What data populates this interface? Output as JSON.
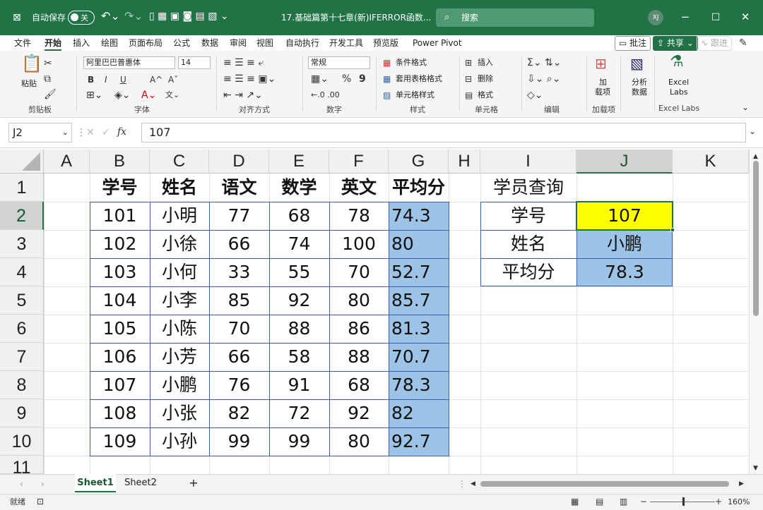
{
  "titlebar": {
    "autosave_label": "自动保存",
    "autosave_state": "关",
    "filename": "17.基础篇第十七章(新)IFERROR函数... ⌄",
    "search_placeholder": "搜索",
    "user_initials": "XJ",
    "accent": "#217346"
  },
  "menu": {
    "items": [
      "文件",
      "开始",
      "插入",
      "绘图",
      "页面布局",
      "公式",
      "数据",
      "审阅",
      "视图",
      "自动执行",
      "开发工具",
      "预览版",
      "Power Pivot"
    ],
    "active": "开始",
    "comments": "批注",
    "share": "共享",
    "follow": "跟进"
  },
  "ribbon": {
    "clipboard": {
      "paste": "粘贴",
      "group": "剪贴板"
    },
    "font": {
      "name": "阿里巴巴普惠体",
      "size": "14",
      "bold": "B",
      "italic": "I",
      "underline": "U",
      "grow": "A^",
      "shrink": "Aˇ",
      "group": "字体"
    },
    "alignment": {
      "group": "对齐方式"
    },
    "number": {
      "format": "常规",
      "percent": "%",
      "comma": "9",
      "group": "数字"
    },
    "styles": {
      "cond": "条件格式",
      "table": "套用表格格式",
      "cell": "单元格样式",
      "group": "样式"
    },
    "cells": {
      "insert": "插入",
      "delete": "删除",
      "format": "格式",
      "group": "单元格"
    },
    "editing": {
      "group": "编辑"
    },
    "addins": {
      "label1": "加",
      "label2": "载项",
      "group": "加载项"
    },
    "analyze": {
      "label1": "分析",
      "label2": "数据"
    },
    "labs": {
      "label1": "Excel",
      "label2": "Labs",
      "group": "Excel Labs"
    }
  },
  "formula_bar": {
    "name_box": "J2",
    "fx": "fx",
    "value": "107"
  },
  "grid": {
    "columns": [
      "A",
      "B",
      "C",
      "D",
      "E",
      "F",
      "G",
      "H",
      "I",
      "J",
      "K"
    ],
    "rows": [
      "1",
      "2",
      "3",
      "4",
      "5",
      "6",
      "7",
      "8",
      "9",
      "10",
      "11"
    ],
    "selected_col": "J",
    "selected_row": "2",
    "table_headers": [
      "学号",
      "姓名",
      "语文",
      "数学",
      "英文",
      "平均分"
    ],
    "table_rows": [
      [
        "101",
        "小明",
        "77",
        "68",
        "78",
        "74.3"
      ],
      [
        "102",
        "小徐",
        "66",
        "74",
        "100",
        "80"
      ],
      [
        "103",
        "小何",
        "33",
        "55",
        "70",
        "52.7"
      ],
      [
        "104",
        "小李",
        "85",
        "92",
        "80",
        "85.7"
      ],
      [
        "105",
        "小陈",
        "70",
        "88",
        "86",
        "81.3"
      ],
      [
        "106",
        "小芳",
        "66",
        "58",
        "88",
        "70.7"
      ],
      [
        "107",
        "小鹏",
        "76",
        "91",
        "68",
        "78.3"
      ],
      [
        "108",
        "小张",
        "82",
        "72",
        "92",
        "82"
      ],
      [
        "109",
        "小孙",
        "99",
        "99",
        "80",
        "92.7"
      ]
    ],
    "lookup": {
      "title": "学员查询",
      "rows": [
        {
          "label": "学号",
          "value": "107"
        },
        {
          "label": "姓名",
          "value": "小鹏"
        },
        {
          "label": "平均分",
          "value": "78.3"
        }
      ]
    },
    "avg_fill": "#9dc3e6",
    "input_fill": "#ffff00"
  },
  "sheets": {
    "tabs": [
      "Sheet1",
      "Sheet2"
    ],
    "active": "Sheet1",
    "add": "+"
  },
  "status": {
    "ready": "就绪",
    "zoom": "160%",
    "minus": "−",
    "plus": "+"
  }
}
